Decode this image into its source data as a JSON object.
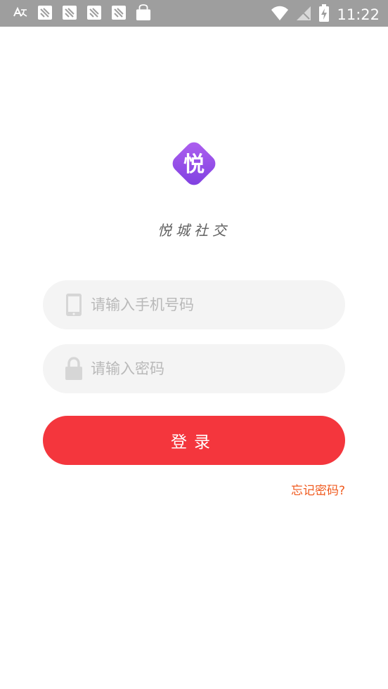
{
  "status_bar": {
    "time": "11:22",
    "background": "#9e9e9e",
    "left_icons": [
      "translate-icon",
      "app-notification-icon",
      "app-notification-icon",
      "app-notification-icon",
      "app-notification-icon",
      "shopping-bag-icon"
    ],
    "right_icons": [
      "wifi-icon",
      "no-signal-icon",
      "battery-charging-icon"
    ]
  },
  "brand": {
    "logo_char": "悦",
    "logo_gradient": [
      "#b061f0",
      "#7d3fe0"
    ],
    "app_name": "悦城社交"
  },
  "login_form": {
    "phone": {
      "placeholder": "请输入手机号码",
      "value": "",
      "icon": "phone-icon"
    },
    "password": {
      "placeholder": "请输入密码",
      "value": "",
      "icon": "lock-icon"
    },
    "submit_label": "登录",
    "forgot_label": "忘记密码?"
  },
  "colors": {
    "primary": "#f4363d",
    "link": "#f05a1e",
    "field_bg": "#f4f4f4",
    "placeholder": "#b9b9b9"
  }
}
